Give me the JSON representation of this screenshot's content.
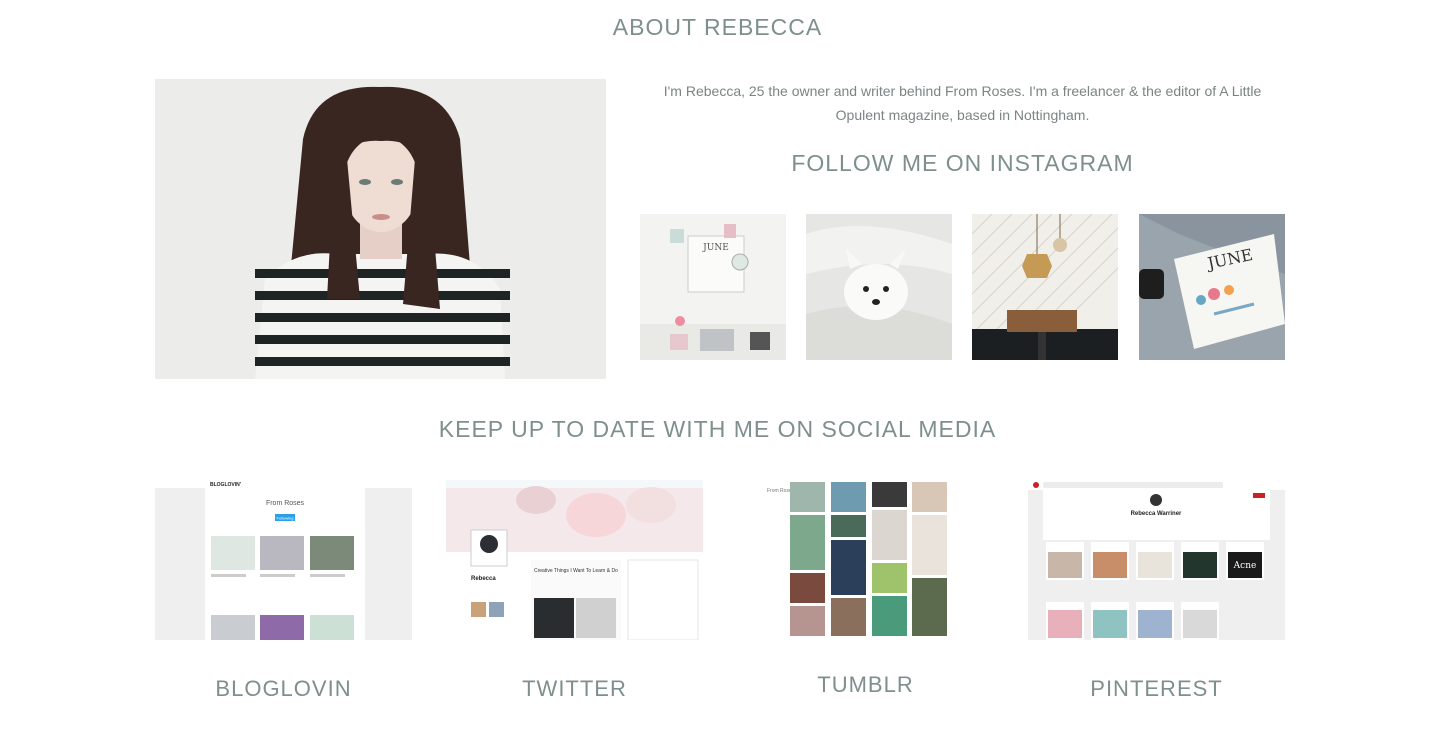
{
  "about": {
    "title": "ABOUT REBECCA",
    "bio": "I'm Rebecca, 25 the owner and writer behind From Roses.  I'm a freelancer & the editor of A Little Opulent magazine, based in Nottingham."
  },
  "instagram": {
    "title": "FOLLOW ME ON INSTAGRAM",
    "thumb_calendar_text": "JUNE",
    "thumb_planner_text": "JUNE"
  },
  "social": {
    "title": "KEEP UP TO DATE WITH ME ON SOCIAL MEDIA",
    "items": [
      {
        "label": "BLOGLOVIN",
        "preview_header": "BLOGLOVIN'",
        "preview_title": "From Roses",
        "preview_button": "Following"
      },
      {
        "label": "TWITTER",
        "preview_name": "Rebecca",
        "preview_tweet": "Creative Things I Want To Learn & Do"
      },
      {
        "label": "TUMBLR",
        "preview_title": "From Roses"
      },
      {
        "label": "PINTEREST",
        "preview_name": "Rebecca Warriner",
        "preview_board": "Acne"
      }
    ]
  },
  "colors": {
    "heading": "#7e8f8e",
    "body_text": "#7a8484",
    "pinterest_red": "#cb2027",
    "bloglovin_blue": "#2b9fe8"
  }
}
